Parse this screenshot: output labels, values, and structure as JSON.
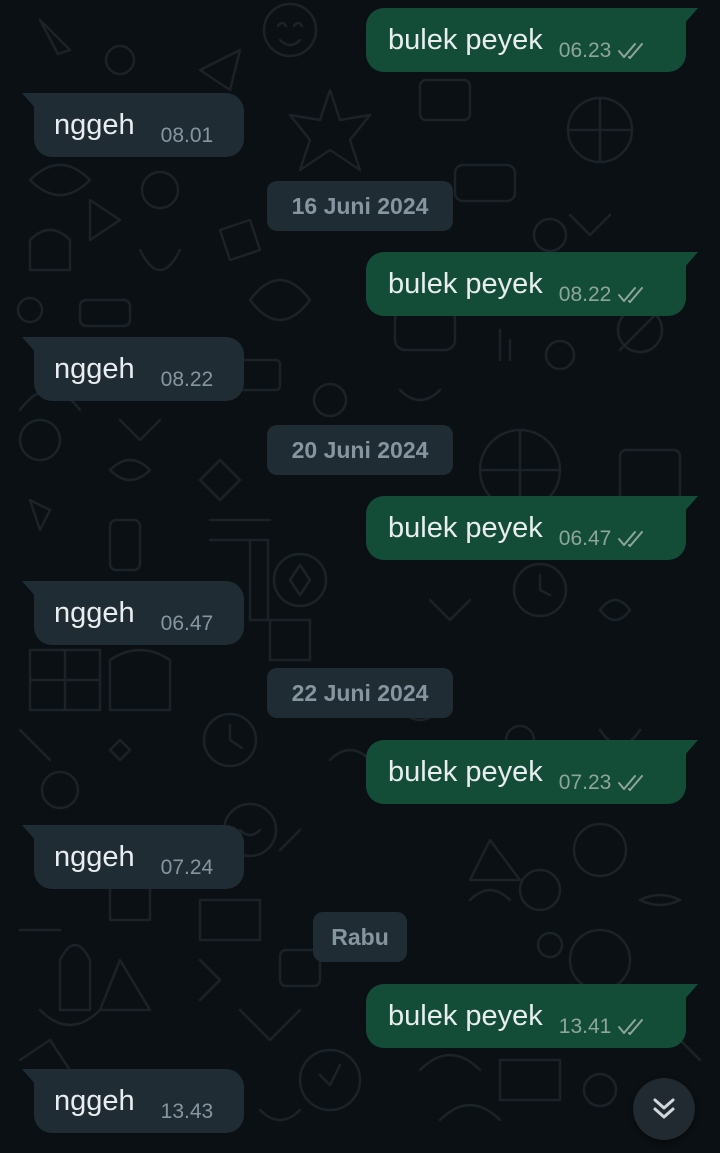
{
  "messages": [
    {
      "direction": "out",
      "text": "bulek peyek",
      "time": "06.23",
      "status": "read"
    },
    {
      "direction": "in",
      "text": "nggeh",
      "time": "08.01"
    },
    {
      "direction": "date",
      "label": "16 Juni 2024"
    },
    {
      "direction": "out",
      "text": "bulek peyek",
      "time": "08.22",
      "status": "read"
    },
    {
      "direction": "in",
      "text": "nggeh",
      "time": "08.22"
    },
    {
      "direction": "date",
      "label": "20 Juni 2024"
    },
    {
      "direction": "out",
      "text": "bulek peyek",
      "time": "06.47",
      "status": "read"
    },
    {
      "direction": "in",
      "text": "nggeh",
      "time": "06.47"
    },
    {
      "direction": "date",
      "label": "22 Juni 2024"
    },
    {
      "direction": "out",
      "text": "bulek peyek",
      "time": "07.23",
      "status": "read"
    },
    {
      "direction": "in",
      "text": "nggeh",
      "time": "07.24"
    },
    {
      "direction": "date",
      "label": "Rabu"
    },
    {
      "direction": "out",
      "text": "bulek peyek",
      "time": "13.41",
      "status": "read"
    },
    {
      "direction": "in",
      "text": "nggeh",
      "time": "13.43"
    }
  ],
  "scroll_button": {
    "icon": "double-chevron-down-icon"
  },
  "colors": {
    "background": "#0b1014",
    "outgoing_bubble": "#134d37",
    "incoming_bubble": "#1f2c34",
    "text": "#e9edef",
    "meta_text": "#8696a0"
  }
}
